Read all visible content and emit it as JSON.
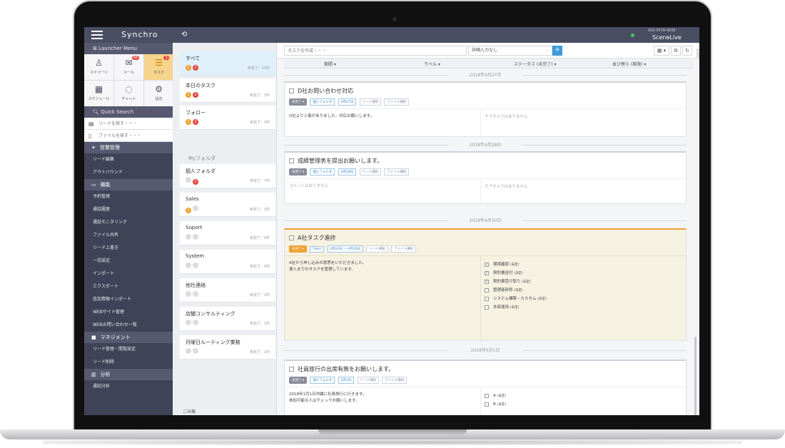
{
  "app": {
    "logo": "Synchro",
    "phone": "050-5578-4039",
    "company": "SceneLive"
  },
  "sidebar": {
    "launcher_label": "Launcher Menu",
    "tiles": [
      {
        "label": "マイページ",
        "icon": "user-icon",
        "badge": ""
      },
      {
        "label": "メール",
        "icon": "mail-icon",
        "badge": "68"
      },
      {
        "label": "タスク",
        "icon": "task-icon",
        "badge": "3"
      },
      {
        "label": "スケジュール",
        "icon": "calendar-icon",
        "badge": ""
      },
      {
        "label": "チャット",
        "icon": "chat-icon",
        "badge": ""
      },
      {
        "label": "設定",
        "icon": "gear-icon",
        "badge": ""
      }
    ],
    "quick_search": "Quick Search",
    "lead_search_placeholder": "リードを探す・・・",
    "file_search_placeholder": "ファイルを探す・・・",
    "sections": [
      {
        "label": "営業管理",
        "items": [
          "リード編集",
          "アウトバウンド"
        ]
      },
      {
        "label": "機能",
        "items": [
          "予約管理",
          "通話履歴",
          "通話モニタリング",
          "ファイル共有",
          "リード上書き",
          "一括設定",
          "インポート",
          "エクスポート",
          "追加情報インポート",
          "WEBサイト管理",
          "WEBお問い合わせ一覧"
        ]
      },
      {
        "label": "マネジメント",
        "items": [
          "リード管理・閲覧設定",
          "リード削除"
        ]
      },
      {
        "label": "分析",
        "items": [
          "通話分析"
        ]
      }
    ]
  },
  "folders": {
    "my_folder_label": "Myフォルダ",
    "bottom_label": "ごみ箱",
    "items": [
      {
        "name": "すべて",
        "count": "未完了：13件",
        "a": "1",
        "b": "2"
      },
      {
        "name": "本日のタスク",
        "count": "未完了：3件",
        "a": "1",
        "b": "2"
      },
      {
        "name": "フォロー",
        "count": "未完了：3件",
        "a": "1",
        "b": "2"
      },
      {
        "name": "個人フォルダ",
        "count": "未完了：7件",
        "a": "",
        "b": "2"
      },
      {
        "name": "Sales",
        "count": "未完了：2件",
        "a": "1",
        "b": ""
      },
      {
        "name": "Suport",
        "count": "未完了：0件",
        "a": "",
        "b": ""
      },
      {
        "name": "System",
        "count": "未完了：0件",
        "a": "",
        "b": ""
      },
      {
        "name": "他社連絡",
        "count": "未完了：2件",
        "a": "",
        "b": ""
      },
      {
        "name": "店舗コンサルティング",
        "count": "未完了：1件",
        "a": "",
        "b": ""
      },
      {
        "name": "月曜日ルーティング業務",
        "count": "未完了：1件",
        "a": "",
        "b": ""
      }
    ]
  },
  "toolbar": {
    "task_placeholder": "タスクを作成・・・",
    "filter_select": "詳細入力なし",
    "add": "+",
    "view": "▦ ▾",
    "settings": "⚙",
    "refresh": "↻"
  },
  "columns": [
    "期間 ▾",
    "ラベル ▾",
    "ステータス (未完了) ▾",
    "並び替え (期限) ▾"
  ],
  "dates": [
    "2018年4月27日",
    "2018年4月28日",
    "2018年4月30日",
    "2018年5月1日"
  ],
  "cards": [
    {
      "title": "D社お問い合わせ対応",
      "status": "未完了 ▾",
      "tags": [
        "個人フォルダ",
        "4月27日",
        "リード選択",
        "ファイル選択"
      ],
      "body": [
        "D社より入電がありました。対応お願いします。"
      ],
      "right": "サブタスクはありません"
    },
    {
      "title": "成績管理表を提出お願いします。",
      "status": "未完了 ▾",
      "tags": [
        "個人フォルダ",
        "4月28日",
        "リード選択",
        "ファイル選択"
      ],
      "body": [
        "コメントはありません"
      ],
      "right": "サブタスクはありません"
    },
    {
      "title": "A社タスク進捗",
      "status": "未完了 ▾",
      "tags": [
        "Sales",
        "4月26日 〜 4月30日",
        "リード選択",
        "ファイル選択"
      ],
      "body": [
        "A社から申し込みの意思をいただきました。",
        "導入までのタスクを管理しています。"
      ],
      "subtasks": [
        {
          "label": "環境確認",
          "state": "(未定)",
          "checked": true
        },
        {
          "label": "契約書送付",
          "state": "(未定)",
          "checked": true
        },
        {
          "label": "契約書受け取り",
          "state": "(未定)",
          "checked": true
        },
        {
          "label": "管理者研修",
          "state": "(未定)",
          "checked": false
        },
        {
          "label": "システム構築・カスタム",
          "state": "(未定)",
          "checked": false
        },
        {
          "label": "本部運用",
          "state": "(未定)",
          "checked": false
        }
      ]
    },
    {
      "title": "社員旅行の出席有無をお願いします。",
      "status": "未完了 ▾",
      "tags": [
        "個人フォルダ",
        "5月1日",
        "リード選択",
        "ファイル選択"
      ],
      "body": [
        "2018年1月1日沖縄に社員旅行に行きます。",
        "参加可能な人はチェックお願いします。"
      ],
      "subtasks": [
        {
          "label": "A",
          "state": "(未定)",
          "checked": false
        },
        {
          "label": "B",
          "state": "(未定)",
          "checked": false
        }
      ]
    }
  ]
}
